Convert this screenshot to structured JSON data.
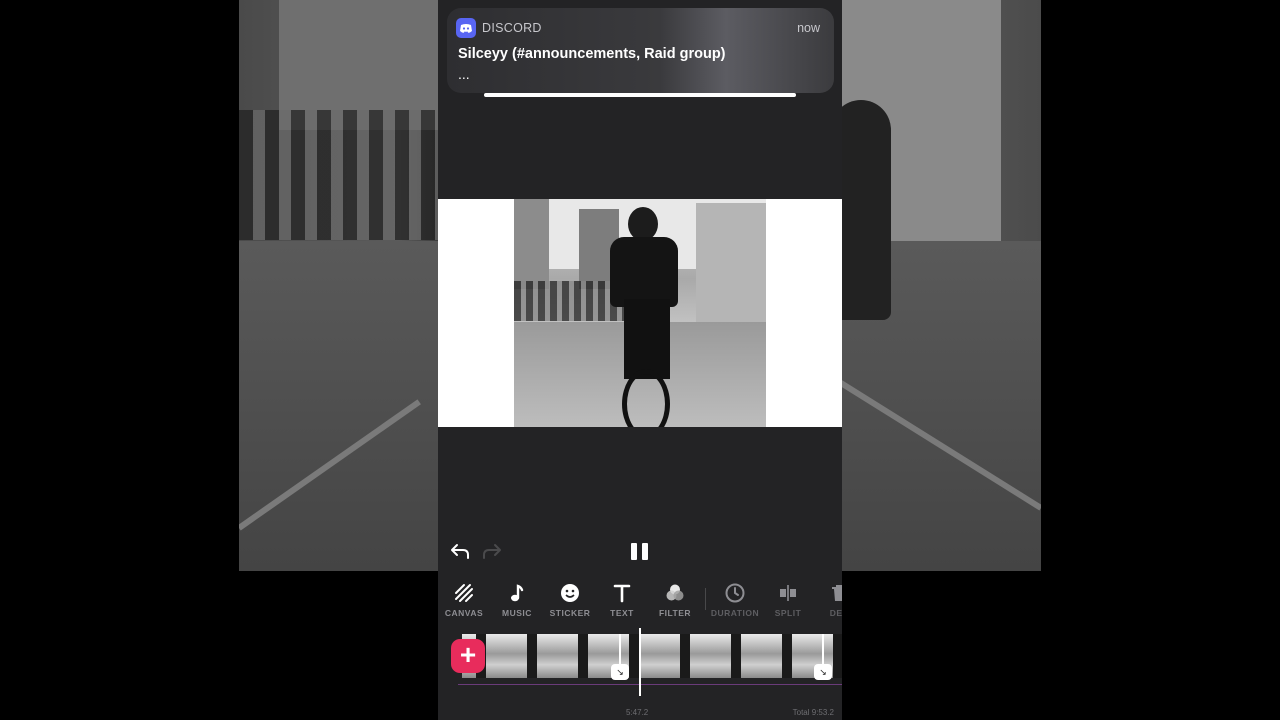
{
  "notification": {
    "app": "DISCORD",
    "time": "now",
    "title": "Silceyy (#announcements, Raid group)",
    "body": "..."
  },
  "toolbar": {
    "items": [
      {
        "label": "CANVAS",
        "icon": "canvas-icon"
      },
      {
        "label": "MUSIC",
        "icon": "music-note-icon"
      },
      {
        "label": "STICKER",
        "icon": "smiley-icon"
      },
      {
        "label": "TEXT",
        "icon": "text-icon"
      },
      {
        "label": "FILTER",
        "icon": "filter-icon"
      },
      {
        "label": "DURATION",
        "icon": "clock-icon"
      },
      {
        "label": "SPLIT",
        "icon": "split-icon"
      },
      {
        "label": "DEL",
        "icon": "trash-icon"
      }
    ]
  },
  "timeline": {
    "current_time": "5:47.2",
    "total_time": "Total 9:53.2"
  },
  "colors": {
    "accent": "#e82c5c",
    "background": "#232325",
    "discord": "#5865f2"
  }
}
